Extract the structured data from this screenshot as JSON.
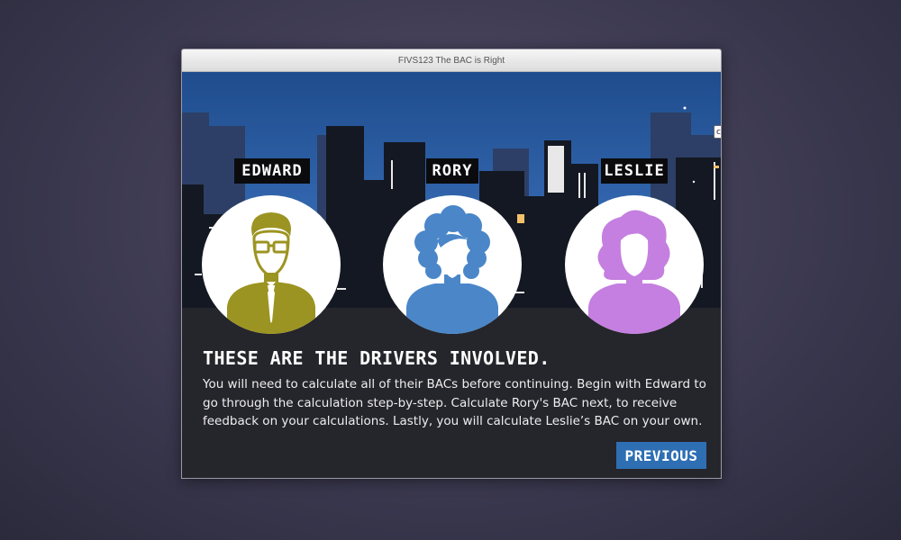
{
  "window": {
    "title": "FIVS123 The BAC is Right"
  },
  "drivers": [
    {
      "name": "EDWARD",
      "color": "#9c9422",
      "icon": "man-with-glasses-and-tie-icon"
    },
    {
      "name": "RORY",
      "color": "#4a86c8",
      "icon": "curly-hair-person-icon"
    },
    {
      "name": "LESLIE",
      "color": "#c57fe0",
      "icon": "wavy-hair-woman-icon"
    }
  ],
  "content": {
    "heading": "THESE ARE THE DRIVERS INVOLVED.",
    "body": "You will need to calculate all of their BACs before continuing. Begin with Edward to go through the calculation step-by-step. Calculate Rory's BAC next, to receive feedback on your calculations. Lastly, you will calculate Leslie’s BAC on your own."
  },
  "buttons": {
    "previous": "PREVIOUS"
  },
  "colors": {
    "sky_top": "#1f4c8c",
    "sky_bottom": "#3f78c6",
    "accent_button": "#2e6fb3",
    "panel": "#25252c"
  }
}
